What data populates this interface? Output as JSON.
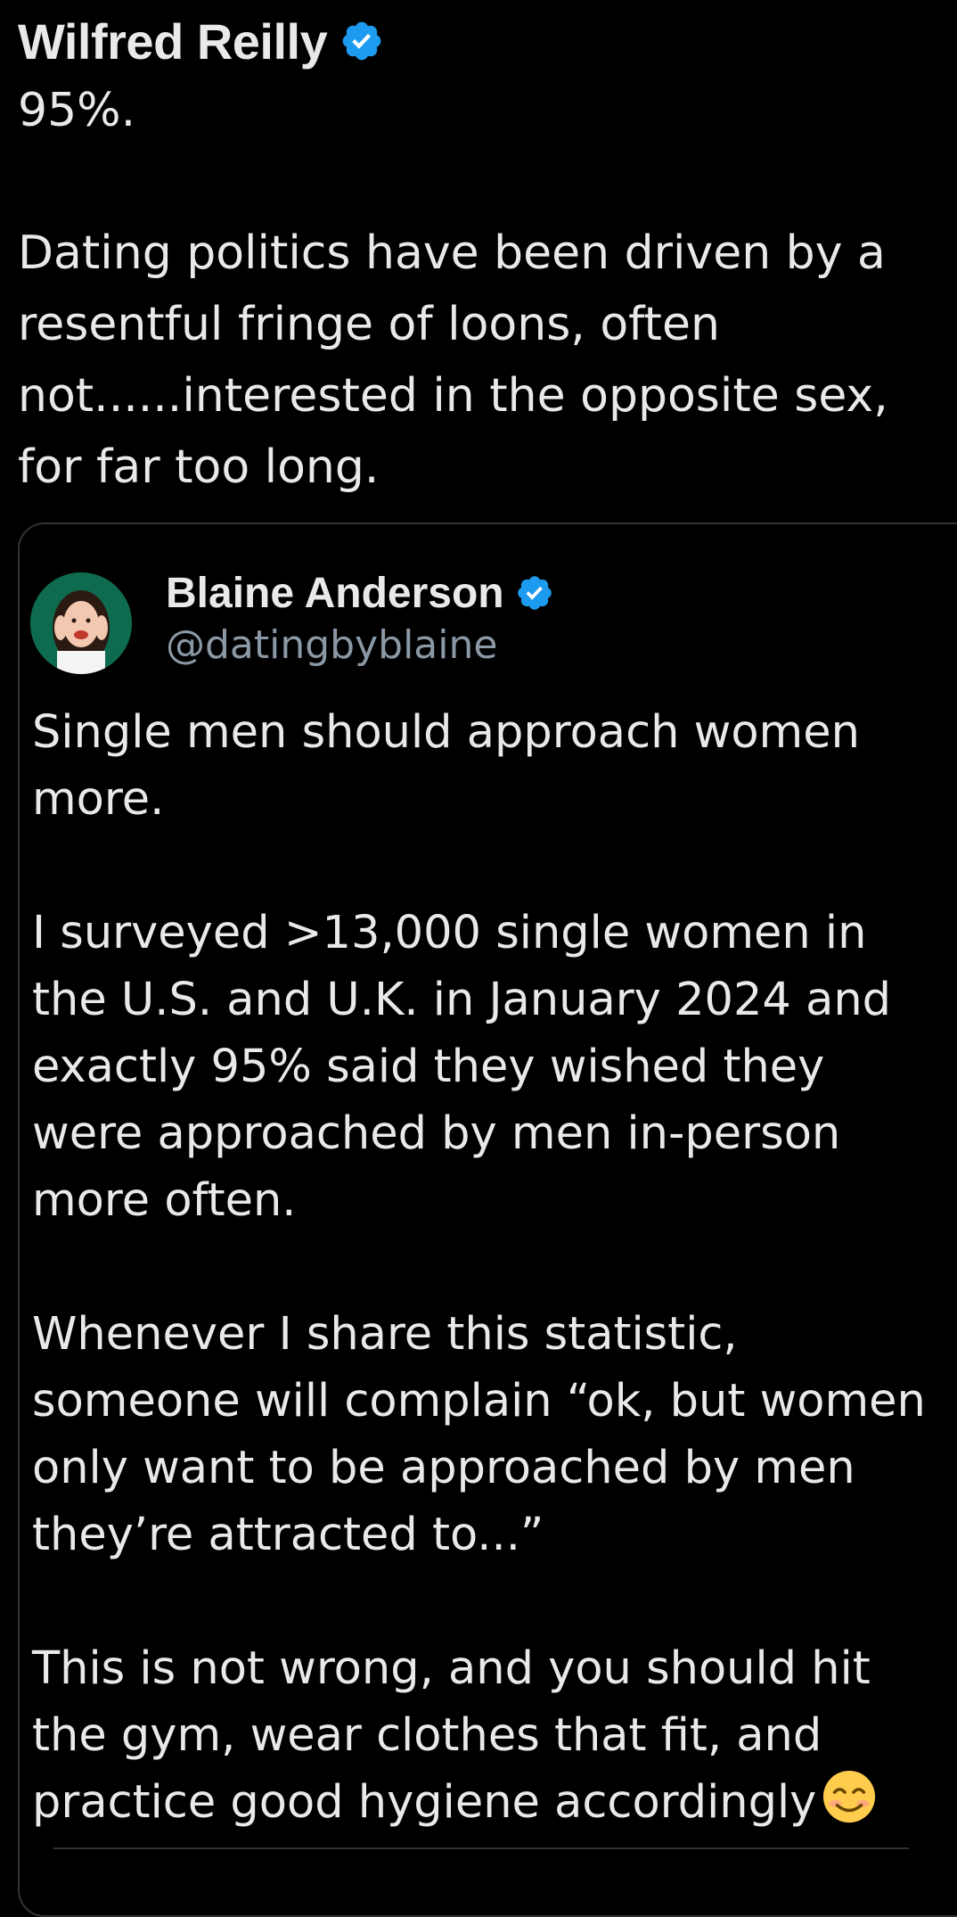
{
  "tweet": {
    "author_name": "Wilfred Reilly",
    "verified_icon": "verified-badge-icon",
    "text": "95%.\n\nDating politics have been driven by a resentful fringe of loons, often not......interested in the opposite sex, for far too long."
  },
  "quoted_tweet": {
    "author_name": "Blaine Anderson",
    "handle": "@datingbyblaine",
    "verified_icon": "verified-badge-icon",
    "avatar": "profile-photo",
    "text": "Single men should approach women more.\n\nI surveyed >13,000 single women in the U.S. and U.K. in January 2024 and exactly 95% said they wished they were approached by men in-person more often.\n\nWhenever I share this statistic, someone will complain “ok, but women only want to be approached by men they’re attracted to...”\n\nThis is not wrong, and you should hit the gym, wear clothes that fit, and practice good hygiene accordingly",
    "trailing_emoji": "smiling-face-emoji"
  },
  "colors": {
    "background": "#000000",
    "text": "#e7e9ea",
    "secondary_text": "#8b98a5",
    "verified_blue": "#1d9bf0",
    "border": "#2f3336"
  }
}
